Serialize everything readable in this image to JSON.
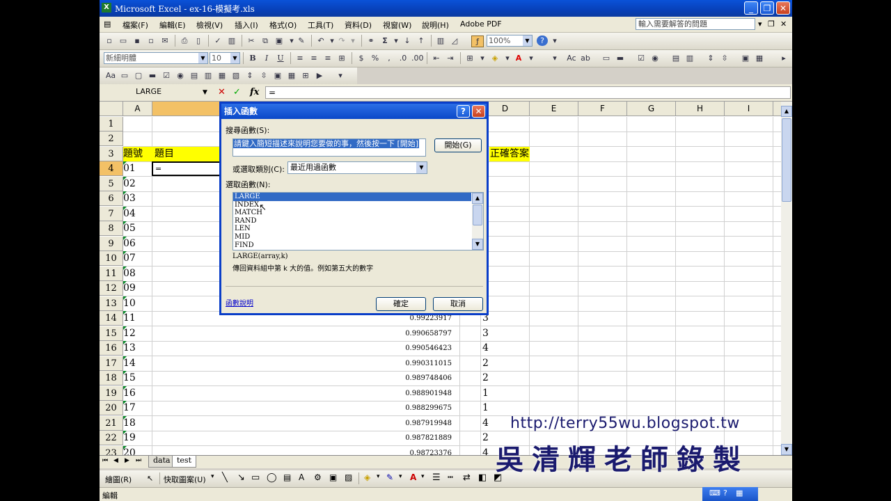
{
  "window": {
    "title": "Microsoft Excel - ex-16-模擬考.xls"
  },
  "menu": {
    "items": [
      "檔案(F)",
      "編輯(E)",
      "檢視(V)",
      "插入(I)",
      "格式(O)",
      "工具(T)",
      "資料(D)",
      "視窗(W)",
      "說明(H)",
      "Adobe PDF"
    ],
    "help_placeholder": "輸入需要解答的問題"
  },
  "toolbar": {
    "zoom": "100%",
    "font_name": "新細明體",
    "font_size": "10"
  },
  "formula_bar": {
    "name_box": "LARGE",
    "formula": "="
  },
  "columns": [
    "A",
    "B",
    "C",
    "D",
    "E",
    "F",
    "G",
    "H",
    "I"
  ],
  "rows": [
    "1",
    "2",
    "3",
    "4",
    "5",
    "6",
    "7",
    "8",
    "9",
    "10",
    "11",
    "12",
    "13",
    "14",
    "15",
    "16",
    "17",
    "18",
    "19",
    "20",
    "21",
    "22",
    "23"
  ],
  "cells": {
    "a3": "題號",
    "b3": "題目",
    "d3": "正確答案",
    "b4": "=",
    "ids": [
      "01",
      "02",
      "03",
      "04",
      "05",
      "06",
      "07",
      "08",
      "09",
      "10",
      "11",
      "12",
      "13",
      "14",
      "15",
      "16",
      "17",
      "18",
      "19",
      "20"
    ],
    "c_values": [
      "0.99223917",
      "0.990658797",
      "0.990546423",
      "0.990311015",
      "0.989748406",
      "0.988901948",
      "0.988299675",
      "0.987919948",
      "0.987821889",
      "0.98723376"
    ],
    "d_values": [
      "3",
      "3",
      "4",
      "2",
      "2",
      "1",
      "1",
      "4",
      "2",
      "4"
    ]
  },
  "sheet_tabs": [
    "data",
    "test"
  ],
  "status": {
    "mode": "編輯"
  },
  "draw_toolbar": {
    "draw_label": "繪圖(R)",
    "autoshape_label": "快取圖案(U)"
  },
  "dialog": {
    "title": "插入函數",
    "search_label": "搜尋函數(S):",
    "search_text": "請鍵入簡短描述來說明您要做的事，然後按一下 [開始]",
    "go_button": "開始(G)",
    "category_label": "或選取類別(C):",
    "category_value": "最近用過函數",
    "select_label": "選取函數(N):",
    "functions": [
      "LARGE",
      "INDEX",
      "MATCH",
      "RAND",
      "LEN",
      "MID",
      "FIND"
    ],
    "selected_function": "LARGE",
    "signature": "LARGE(array,k)",
    "description": "傳回資料組中第 k 大的值。例如第五大的數字",
    "help_link": "函數說明",
    "ok_button": "確定",
    "cancel_button": "取消"
  },
  "watermark": {
    "url": "http://terry55wu.blogspot.tw",
    "name": "吳清輝老師錄製"
  }
}
